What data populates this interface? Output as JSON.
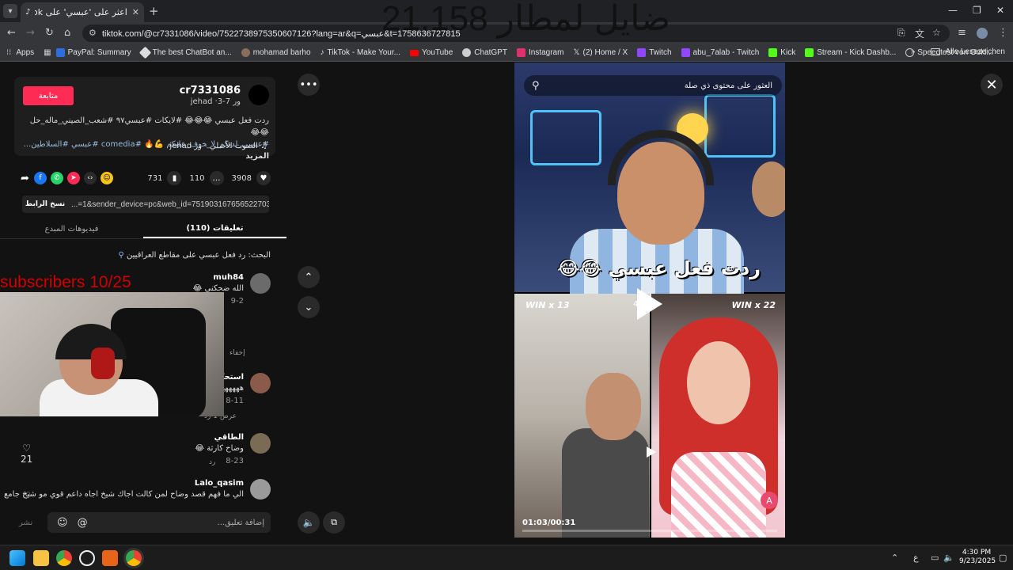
{
  "browser": {
    "tab_title": "اعثر على 'عبسي' على TikTok | بحـ",
    "url": "tiktok.com/@cr7331086/video/7522738975350607126?lang=ar&q=عبسي&t=1758636727815",
    "window_controls": [
      "—",
      "❐",
      "✕"
    ]
  },
  "bookmarks": {
    "items": [
      {
        "label": "Apps",
        "color": "#888888"
      },
      {
        "label": "PayPal: Summary",
        "color": "#2a6fdb"
      },
      {
        "label": "The best ChatBot an...",
        "color": "#dddddd"
      },
      {
        "label": "mohamad barho",
        "color": "#8a6d5a"
      },
      {
        "label": "TikTok - Make Your...",
        "color": "#ffffff"
      },
      {
        "label": "YouTube",
        "color": "#ff0000"
      },
      {
        "label": "ChatGPT",
        "color": "#cccccc"
      },
      {
        "label": "Instagram",
        "color": "#e1306c"
      },
      {
        "label": "(2) Home / X",
        "color": "#ffffff"
      },
      {
        "label": "Twitch",
        "color": "#9146ff"
      },
      {
        "label": "abu_7alab - Twitch",
        "color": "#9146ff"
      },
      {
        "label": "Kick",
        "color": "#53fc18"
      },
      {
        "label": "Stream - Kick Dashb...",
        "color": "#53fc18"
      },
      {
        "label": "Speedtest von Ookl...",
        "color": "#cccccc"
      }
    ],
    "all_bookmarks": "Alle Lesezeichen"
  },
  "overlay": {
    "title": "ضايل لمطار 21.158",
    "subscribers": "subscribers 10/25"
  },
  "post": {
    "follow_label": "متابعة",
    "username": "cr7331086",
    "subline": "jehad ·ور 7-3",
    "desc_line1": "ردت فعل عبسي 😂😂😂 #لايكات #عبسي٩٧ #شعب_الصيني_ماله_حل 😂😂",
    "desc_line2": "#عبسي_لديكم_لا_خوف_عليكم 💪🔥 #comedia #عبسي #السلاطين...",
    "more": "المزيد",
    "sound": "الصوت الأصلي - ور jehad",
    "likes": "3908",
    "comments": "110",
    "saves": "731",
    "link": "...=1&sender_device=pc&web_id=7519031676565227030",
    "copy_link": "نسخ الرابط"
  },
  "tabs": {
    "comments": "(110) تعليقات",
    "creator_videos": "فيديوهات المبدع"
  },
  "search_hint": "البحث: رد فعل عبسي على مقاطع العراقيين",
  "comments": [
    {
      "name": "muh84",
      "text": "الله ضحكني 😂",
      "date": "9-2",
      "avatar": "#6b6b6b"
    },
    {
      "name": "استحكام",
      "text": "هههههههه",
      "date": "8-11",
      "avatar": "#8a5a4a"
    },
    {
      "name": "الطاقي",
      "text": "وضاح كارثة 😂",
      "date": "8-23",
      "avatar": "#7a6b55"
    },
    {
      "name": "Lalo_qasim",
      "text": "الي ما فهم قصد وضاح لمن كالت اجاك شيخ اجاه داعم قوي مو شيخ جامع",
      "date": "",
      "avatar": "#9a9a9a"
    }
  ],
  "comment_extras": {
    "hide": "إخفاء",
    "show_reply": "عرض 1 رد",
    "reply": "رد",
    "like_count": "21"
  },
  "comment_bar": {
    "placeholder": "إضافة تعليق...",
    "post": "نشر"
  },
  "video": {
    "search_placeholder": "العثور على محتوى ذي صلة",
    "caption": "ردت فعل عبسي 😂😂",
    "win_left": "WIN x 13",
    "win_right": "WIN x 22",
    "timer_small": "45",
    "timecode": "01:03/00:31"
  },
  "taskbar": {
    "time": "4:30 PM",
    "date": "9/23/2025",
    "lang": "ع"
  }
}
